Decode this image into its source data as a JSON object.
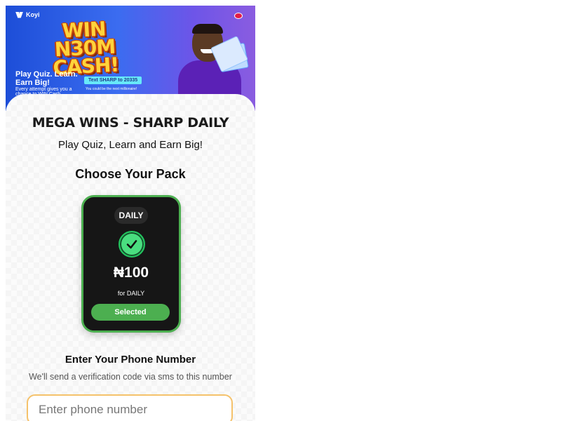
{
  "banner": {
    "brand": "Koyi",
    "headline": "WIN N30M CASH!",
    "tagline": "Play Quiz. Learn. Earn Big!",
    "subtag": "Every attempt gives you a chance to WIN Cash",
    "sms_cta": "Text SHARP to 20335",
    "sms_sub": "You could be the next millionaire!"
  },
  "page": {
    "title": "MEGA WINS - SHARP DAILY",
    "subtitle": "Play Quiz, Learn and Earn Big!",
    "choose_heading": "Choose Your Pack"
  },
  "pack": {
    "label": "DAILY",
    "price": "₦100",
    "period": "for DAILY",
    "button": "Selected"
  },
  "phone": {
    "heading": "Enter Your Phone Number",
    "help": "We'll send a verification code via sms to this number",
    "placeholder": "Enter phone number",
    "value": ""
  },
  "colors": {
    "accent_green": "#4caf50",
    "input_border": "#f5c26b",
    "pack_bg": "#161616"
  },
  "icons": [
    "brand-logo-icon",
    "check-icon"
  ]
}
